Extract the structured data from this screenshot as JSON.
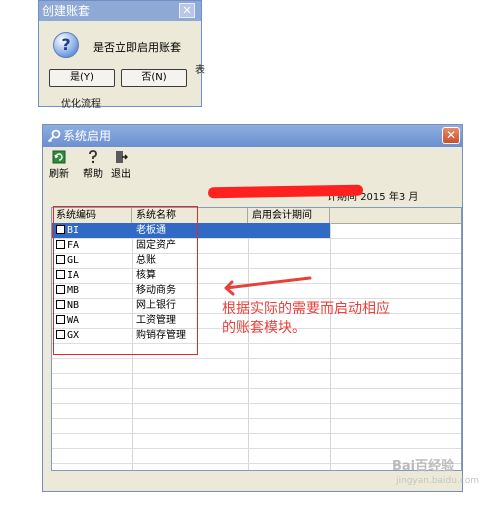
{
  "confirm_dialog": {
    "title": "创建账套",
    "close": "✕",
    "message": "是否立即启用账套",
    "yes": "是(Y)",
    "no": "否(N)",
    "bg_text_1": "表",
    "bg_text_2": "优化流程"
  },
  "system_window": {
    "title": "系统启用",
    "close": "✕",
    "toolbar": {
      "refresh": "刷新",
      "help": "帮助",
      "exit": "退出"
    },
    "period_label": "计期间",
    "period_year": "2015",
    "year_unit": "年3",
    "month_unit": "月",
    "columns": [
      "系统编码",
      "系统名称",
      "启用会计期间"
    ],
    "rows": [
      {
        "code": "BI",
        "name": "老板通",
        "selected": true
      },
      {
        "code": "FA",
        "name": "固定资产",
        "selected": false
      },
      {
        "code": "GL",
        "name": "总账",
        "selected": false
      },
      {
        "code": "IA",
        "name": "核算",
        "selected": false
      },
      {
        "code": "MB",
        "name": "移动商务",
        "selected": false
      },
      {
        "code": "NB",
        "name": "网上银行",
        "selected": false
      },
      {
        "code": "WA",
        "name": "工资管理",
        "selected": false
      },
      {
        "code": "GX",
        "name": "购销存管理",
        "selected": false
      }
    ]
  },
  "annotation": {
    "line1": "根据实际的需要而启动相应",
    "line2": "的账套模块。"
  },
  "watermark": {
    "brand": "Bai百经验",
    "site": "jingyan.baidu.com"
  },
  "colors": {
    "selection": "#316ac5",
    "annotation": "#e8403a",
    "title_bar": "#6b8fd0"
  }
}
